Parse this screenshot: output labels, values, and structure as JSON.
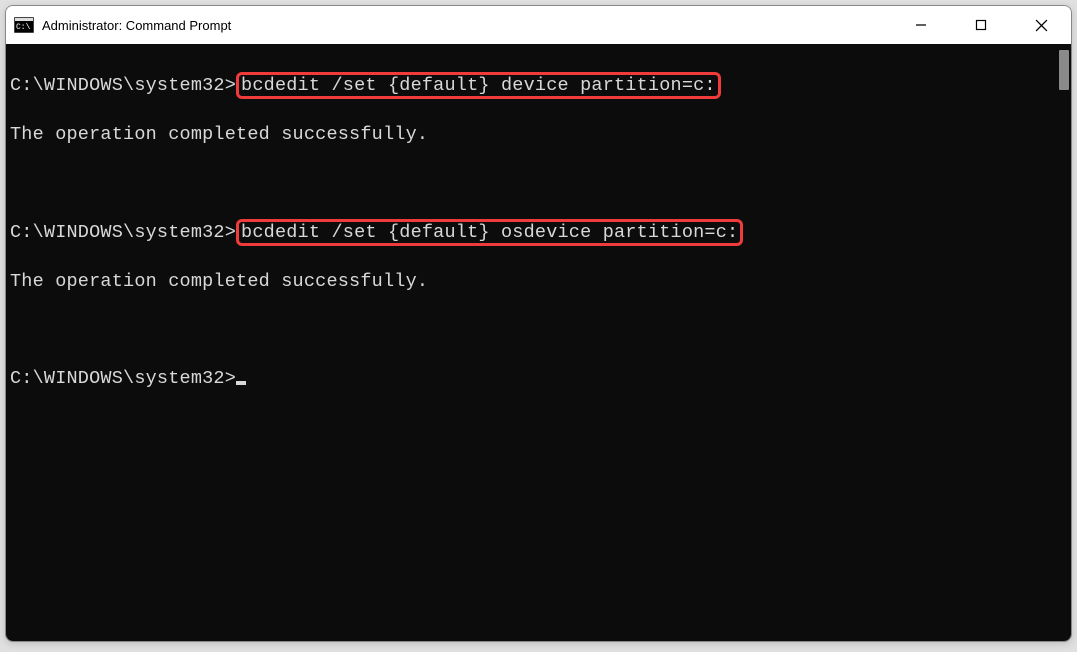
{
  "window": {
    "title": "Administrator: Command Prompt"
  },
  "terminal": {
    "lines": [
      {
        "prompt": "C:\\WINDOWS\\system32>",
        "command": "bcdedit /set {default} device partition=c:",
        "highlighted": true
      },
      {
        "text": "The operation completed successfully."
      },
      {
        "text": ""
      },
      {
        "prompt": "C:\\WINDOWS\\system32>",
        "command": "bcdedit /set {default} osdevice partition=c:",
        "highlighted": true
      },
      {
        "text": "The operation completed successfully."
      },
      {
        "text": ""
      },
      {
        "prompt": "C:\\WINDOWS\\system32>",
        "cursor": true
      }
    ]
  }
}
